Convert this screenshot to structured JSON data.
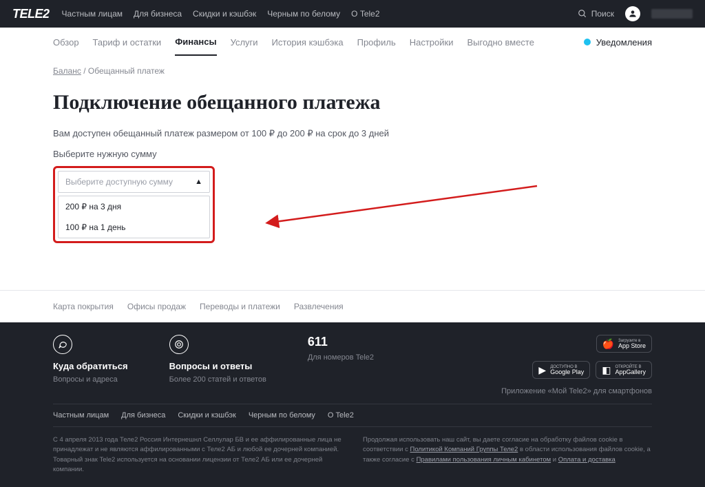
{
  "header": {
    "logo": "TELE2",
    "nav": [
      "Частным лицам",
      "Для бизнеса",
      "Скидки и кэшбэк",
      "Черным по белому",
      "О Tele2"
    ],
    "search": "Поиск"
  },
  "subnav": {
    "items": [
      "Обзор",
      "Тариф и остатки",
      "Финансы",
      "Услуги",
      "История кэшбэка",
      "Профиль",
      "Настройки",
      "Выгодно вместе"
    ],
    "active_index": 2,
    "notifications": "Уведомления"
  },
  "breadcrumb": {
    "link": "Баланс",
    "current": "Обещанный платеж"
  },
  "page": {
    "title": "Подключение обещанного платежа",
    "description": "Вам доступен обещанный платеж размером от 100 ₽ до 200 ₽ на срок до 3 дней",
    "select_label": "Выберите нужную сумму",
    "select_placeholder": "Выберите доступную сумму",
    "dropdown": {
      "options": [
        "200 ₽ на 3 дня",
        "100 ₽ на 1 день"
      ]
    }
  },
  "footer_links": [
    "Карта покрытия",
    "Офисы продаж",
    "Переводы и платежи",
    "Развлечения"
  ],
  "footer": {
    "contact": {
      "title": "Куда обратиться",
      "sub": "Вопросы и адреса"
    },
    "faq": {
      "title": "Вопросы и ответы",
      "sub": "Более 200 статей и ответов"
    },
    "phone": {
      "num": "611",
      "sub": "Для номеров Tele2"
    },
    "stores": {
      "appstore_small": "Загрузите в",
      "appstore": "App Store",
      "gplay_small": "ДОСТУПНО В",
      "gplay": "Google Play",
      "appgallery_small": "ОТКРОЙТЕ В",
      "appgallery": "AppGallery"
    },
    "apps_caption": "Приложение «Мой Tele2» для смартфонов",
    "bottom_nav": [
      "Частным лицам",
      "Для бизнеса",
      "Скидки и кэшбэк",
      "Черным по белому",
      "О Tele2"
    ],
    "legal_left": "С 4 апреля 2013 года Теле2 Россия Интернешнл Селлулар БВ и ее аффилированные лица не принадлежат и не являются аффилированными с Теле2 АБ и любой ее дочерней компанией. Товарный знак Tele2 используется на основании лицензии от Теле2 АБ или ее дочерней компании.",
    "legal_right_1": "Продолжая использовать наш сайт, вы даете согласие на обработку файлов cookie в соответствии с ",
    "legal_right_link1": "Политикой Компаний Группы Теле2",
    "legal_right_2": " в области использования файлов cookie, а также согласие с ",
    "legal_right_link2": "Правилами пользования личным кабинетом",
    "legal_right_3": " и ",
    "legal_right_link3": "Оплата и доставка"
  }
}
